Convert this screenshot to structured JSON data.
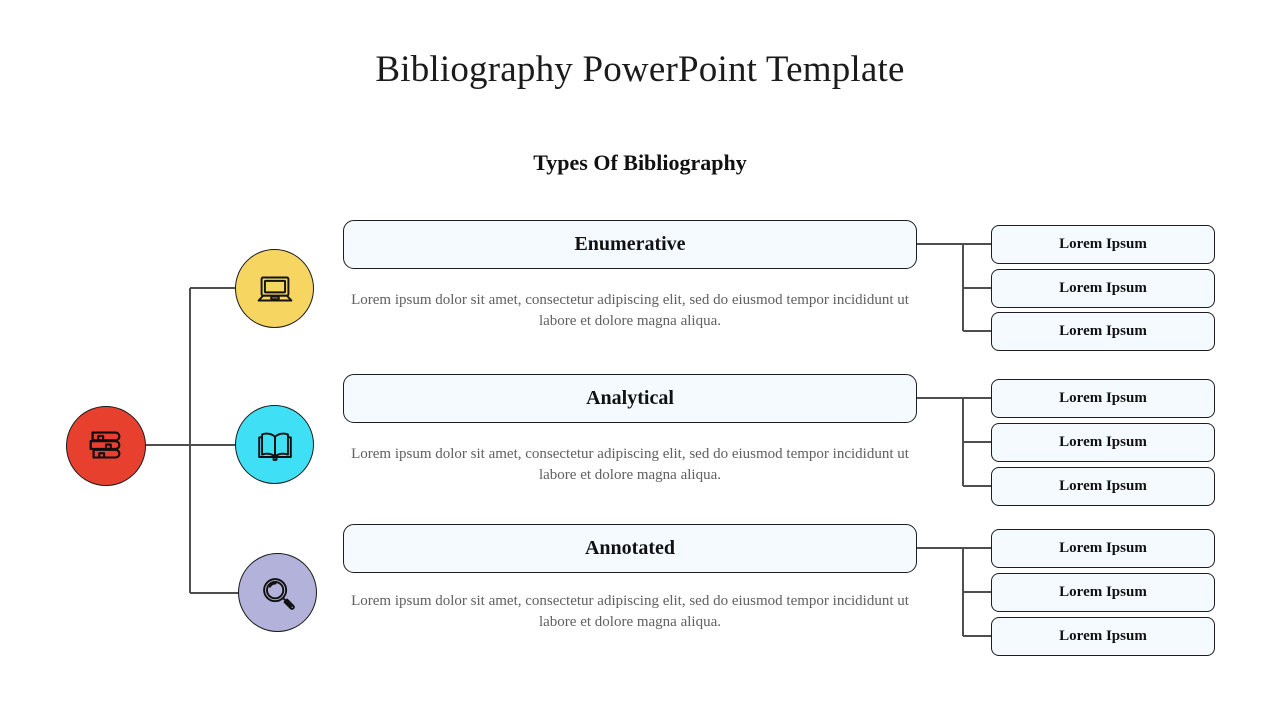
{
  "slide": {
    "title": "Bibliography PowerPoint Template",
    "section_title": "Types Of Bibliography",
    "background_color": "#ffffff"
  },
  "colors": {
    "root_circle": "#e8402f",
    "enumerative_circle": "#f7d561",
    "analytical_circle": "#3fe0f5",
    "annotated_circle": "#b2b2da",
    "box_fill": "#f4faff",
    "box_border": "#1d1d1d",
    "connector": "#5a5a5a",
    "body_text": "#606060",
    "heading_text": "#111111"
  },
  "root": {
    "icon": "stack-of-books-icon"
  },
  "branches": [
    {
      "key": "enumerative",
      "icon": "laptop-icon",
      "circle_color": "#f7d561",
      "title": "Enumerative",
      "body": "Lorem ipsum dolor sit amet, consectetur adipiscing elit, sed do eiusmod tempor incididunt ut labore et dolore magna aliqua.",
      "sub_items": [
        "Lorem Ipsum",
        "Lorem Ipsum",
        "Lorem Ipsum"
      ]
    },
    {
      "key": "analytical",
      "icon": "open-book-icon",
      "circle_color": "#3fe0f5",
      "title": "Analytical",
      "body": "Lorem ipsum dolor sit amet, consectetur adipiscing elit, sed do eiusmod tempor incididunt ut labore et dolore magna aliqua.",
      "sub_items": [
        "Lorem Ipsum",
        "Lorem Ipsum",
        "Lorem Ipsum"
      ]
    },
    {
      "key": "annotated",
      "icon": "magnifying-glass-icon",
      "circle_color": "#b2b2da",
      "title": "Annotated",
      "body": "Lorem ipsum dolor sit amet, consectetur adipiscing elit, sed do eiusmod tempor incididunt ut labore et dolore magna aliqua.",
      "sub_items": [
        "Lorem Ipsum",
        "Lorem Ipsum",
        "Lorem Ipsum"
      ]
    }
  ]
}
